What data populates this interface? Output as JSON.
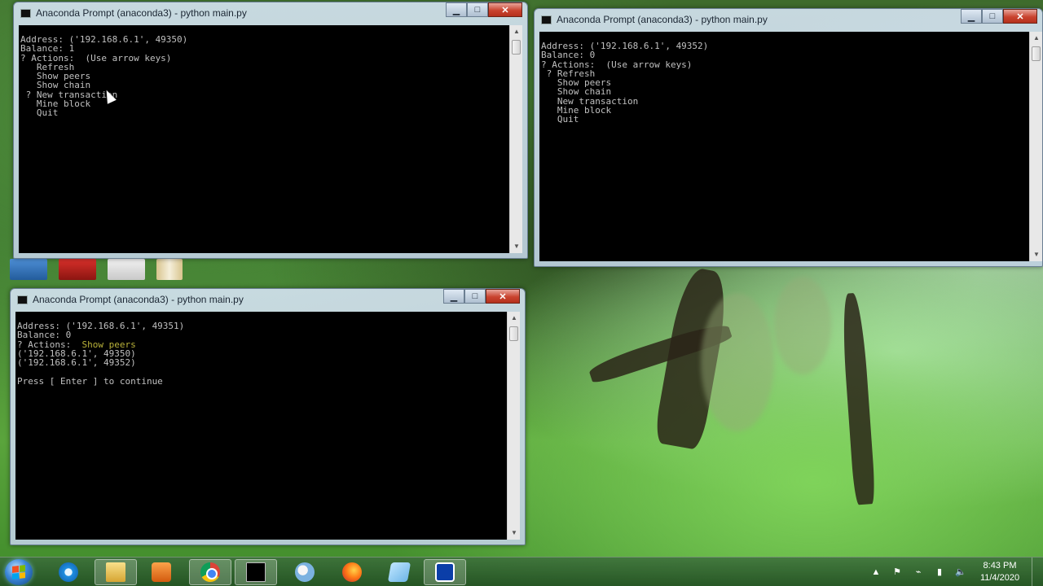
{
  "windows": [
    {
      "title": "Anaconda Prompt (anaconda3) - python  main.py",
      "lines": {
        "address": "Address: ('192.168.6.1', 49350)",
        "balance": "Balance: 1",
        "actions": "? Actions:  (Use arrow keys)",
        "opt_refresh": "   Refresh",
        "opt_peers": "   Show peers",
        "opt_chain": "   Show chain",
        "opt_newtx": " ? New transaction",
        "opt_mine": "   Mine block",
        "opt_quit": "   Quit"
      }
    },
    {
      "title": "Anaconda Prompt (anaconda3) - python  main.py",
      "lines": {
        "address": "Address: ('192.168.6.1', 49352)",
        "balance": "Balance: 0",
        "actions": "? Actions:  (Use arrow keys)",
        "opt_refresh": " ? Refresh",
        "opt_peers": "   Show peers",
        "opt_chain": "   Show chain",
        "opt_newtx": "   New transaction",
        "opt_mine": "   Mine block",
        "opt_quit": "   Quit"
      }
    },
    {
      "title": "Anaconda Prompt (anaconda3) - python  main.py",
      "lines": {
        "address": "Address: ('192.168.6.1', 49351)",
        "balance": "Balance: 0",
        "actions_prefix": "? Actions:  ",
        "actions_answer": "Show peers",
        "peer1": "('192.168.6.1', 49350)",
        "peer2": "('192.168.6.1', 49352)",
        "press": "Press [ Enter ] to continue"
      }
    }
  ],
  "window_controls": {
    "minimize": "▁",
    "maximize": "□",
    "close": "✕"
  },
  "scroll_arrows": {
    "up": "▲",
    "down": "▼"
  },
  "colors": {
    "console_bg": "#000000",
    "console_text": "#c0c0c0",
    "highlight": "#b9b23a"
  },
  "taskbar": {
    "start_icon": "windows-start-orb",
    "pinned": [
      {
        "name": "internet-explorer-icon"
      },
      {
        "name": "file-explorer-icon"
      },
      {
        "name": "media-player-icon"
      },
      {
        "name": "chrome-icon"
      },
      {
        "name": "command-prompt-icon"
      },
      {
        "name": "paint-icon"
      },
      {
        "name": "firefox-icon"
      },
      {
        "name": "sticky-notes-icon"
      },
      {
        "name": "virtualbox-icon"
      }
    ],
    "clock": {
      "time": "8:43 PM",
      "date": "11/4/2020"
    },
    "tray_glyphs": {
      "chevron": "▲",
      "flag": "⚑",
      "power": "⌁",
      "signal": "▮",
      "volume": "🔈"
    }
  }
}
